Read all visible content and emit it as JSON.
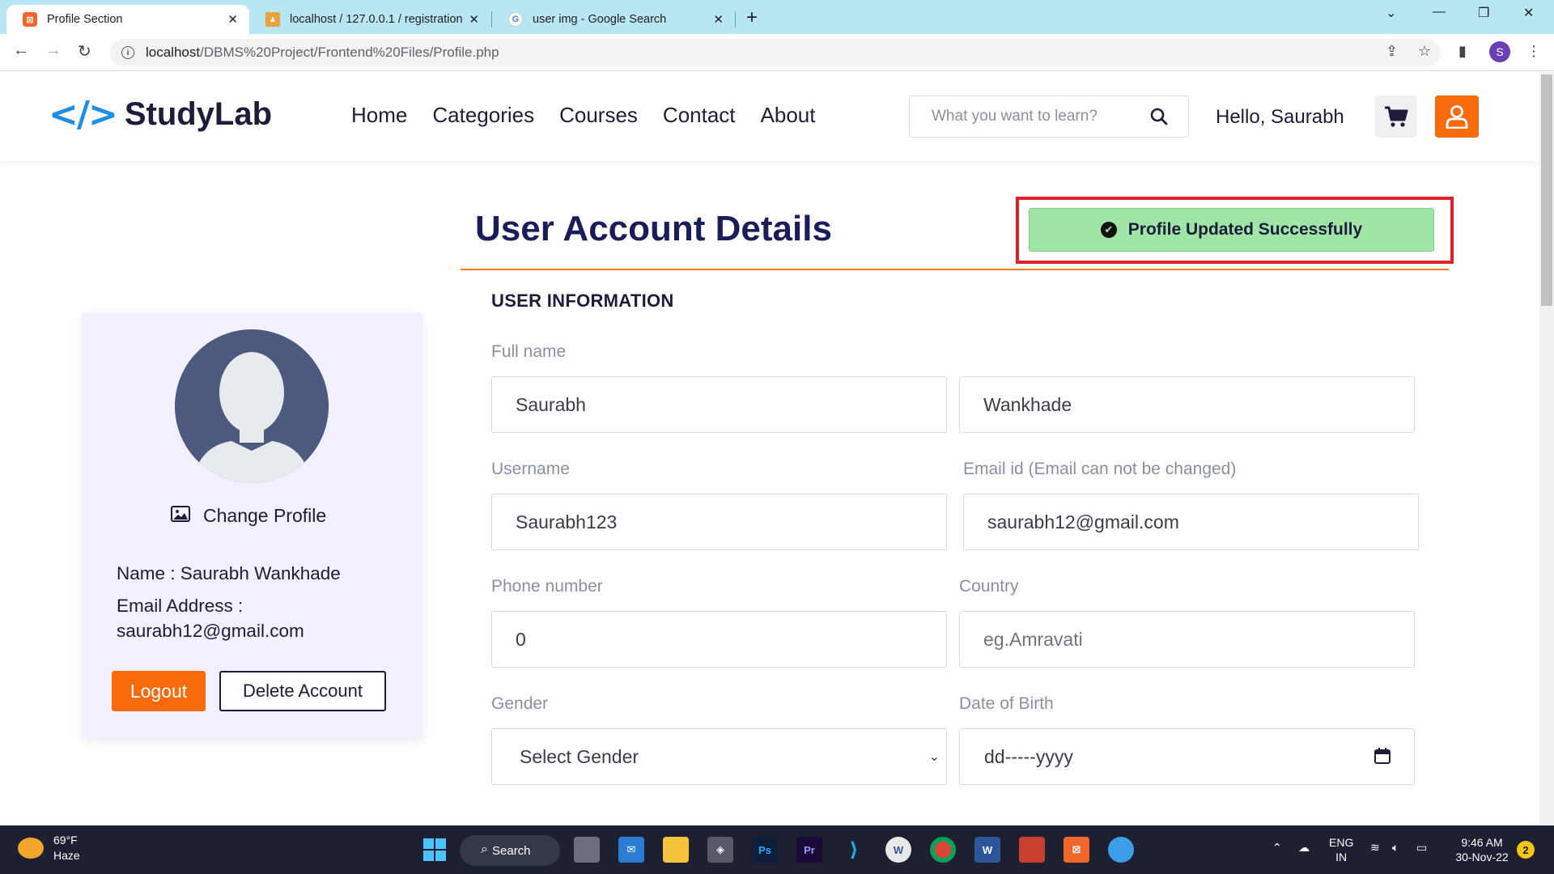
{
  "browser": {
    "tabs": [
      {
        "title": "Profile Section",
        "active": true
      },
      {
        "title": "localhost / 127.0.0.1 / registration",
        "active": false
      },
      {
        "title": "user img - Google Search",
        "active": false
      }
    ],
    "url_host": "localhost",
    "url_path": "/DBMS%20Project/Frontend%20Files/Profile.php",
    "profile_initial": "S"
  },
  "site": {
    "logo_mark": "</>",
    "logo_text": "StudyLab",
    "nav": [
      "Home",
      "Categories",
      "Courses",
      "Contact",
      "About"
    ],
    "search_placeholder": "What you want to learn?",
    "greeting": "Hello, Saurabh",
    "accent_color": "#f76b0d"
  },
  "page": {
    "title": "User Account Details",
    "alert": "Profile Updated Successfully"
  },
  "profile_card": {
    "change_profile": "Change Profile",
    "name_line": "Name : Saurabh Wankhade",
    "email_label": "Email Address :",
    "email_value": "saurabh12@gmail.com",
    "logout": "Logout",
    "delete": "Delete Account"
  },
  "form": {
    "section": "USER INFORMATION",
    "fullname_label": "Full name",
    "first_name": "Saurabh",
    "last_name": "Wankhade",
    "username_label": "Username",
    "username": "Saurabh123",
    "email_label": "Email id (Email can not be changed)",
    "email": "saurabh12@gmail.com",
    "phone_label": "Phone number",
    "phone": "0",
    "country_label": "Country",
    "country_placeholder": "eg.Amravati",
    "gender_label": "Gender",
    "gender_value": "Select Gender",
    "dob_label": "Date of Birth",
    "dob_placeholder": "dd-----yyyy"
  },
  "taskbar": {
    "weather_temp": "69°F",
    "weather_desc": "Haze",
    "search": "Search",
    "lang_top": "ENG",
    "lang_bottom": "IN",
    "time": "9:46 AM",
    "date": "30-Nov-22",
    "notifications": "2"
  }
}
